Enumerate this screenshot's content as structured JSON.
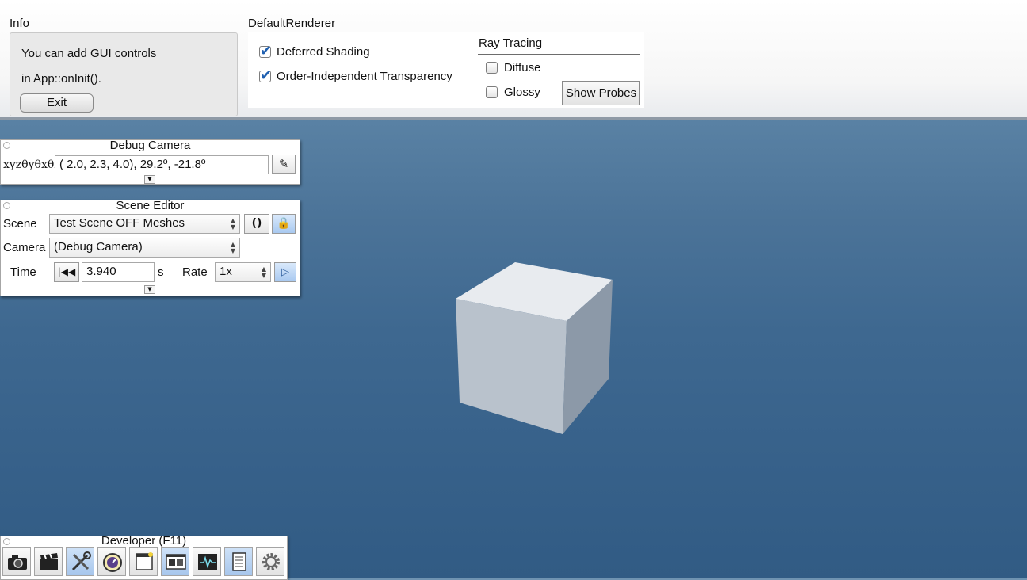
{
  "info": {
    "label": "Info",
    "line1": "You can add GUI controls",
    "line2": "in App::onInit().",
    "exit_label": "Exit"
  },
  "renderer": {
    "label": "DefaultRenderer",
    "deferred_shading": {
      "label": "Deferred Shading",
      "checked": true
    },
    "oit": {
      "label": "Order-Independent Transparency",
      "checked": true
    },
    "ray_tracing": {
      "label": "Ray Tracing",
      "diffuse": {
        "label": "Diffuse",
        "checked": false
      },
      "glossy": {
        "label": "Glossy",
        "checked": false
      },
      "show_probes_label": "Show Probes"
    }
  },
  "debug_camera": {
    "title": "Debug Camera",
    "coord_label": "xyzθyθxθz",
    "value": "(  2.0,   2.3,   4.0),  29.2º, -21.8º",
    "edit_icon": "pencil-icon"
  },
  "scene_editor": {
    "title": "Scene Editor",
    "scene_label": "Scene",
    "scene_value": "Test Scene OFF Meshes",
    "camera_label": "Camera",
    "camera_value": "(Debug Camera)",
    "time_label": "Time",
    "time_value": "3.940",
    "time_unit": "s",
    "rate_label": "Rate",
    "rate_value": "1x",
    "reload_icon": "reload-icon",
    "lock_icon": "lock-icon",
    "rewind_icon": "rewind-icon",
    "play_icon": "play-icon"
  },
  "developer": {
    "title": "Developer (F11)",
    "buttons": [
      {
        "icon": "camera-icon",
        "active": false
      },
      {
        "icon": "clapperboard-icon",
        "active": false
      },
      {
        "icon": "tools-icon",
        "active": true
      },
      {
        "icon": "stopwatch-icon",
        "active": false
      },
      {
        "icon": "window-icon",
        "active": false
      },
      {
        "icon": "scene-windows-icon",
        "active": true
      },
      {
        "icon": "profiler-icon",
        "active": false
      },
      {
        "icon": "log-document-icon",
        "active": true
      },
      {
        "icon": "gear-icon",
        "active": false
      }
    ]
  },
  "colors": {
    "accent": "#1e5fb0",
    "background_top": "#6f93b1",
    "background_bottom": "#315b84",
    "cube_top": "#e8ebef",
    "cube_left": "#b9c2cc",
    "cube_right": "#8c99a8"
  }
}
